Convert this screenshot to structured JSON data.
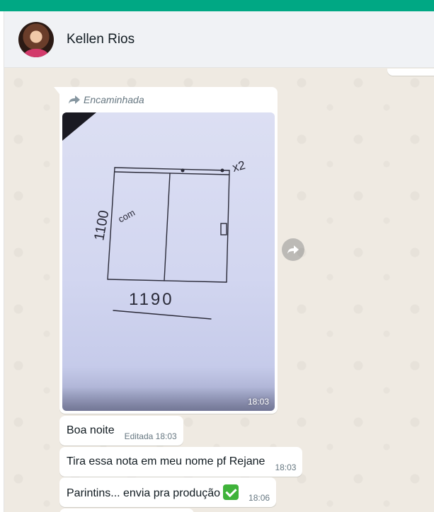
{
  "header": {
    "contact_name": "Kellen Rios"
  },
  "messages": {
    "media": {
      "forwarded_label": "Encaminhada",
      "time": "18:03",
      "drawing": {
        "label_height": "1100",
        "label_width": "1190",
        "label_qty": "x2",
        "label_note": "com"
      }
    },
    "m1": {
      "text": "Boa noite",
      "meta": "Editada 18:03"
    },
    "m2": {
      "text": "Tira essa nota em meu nome pf Rejane",
      "meta": "18:03"
    },
    "m3": {
      "text": "Parintins... envia pra produção",
      "meta": "18:06",
      "emoji": "check-mark-button-emoji"
    }
  },
  "colors": {
    "accent": "#00a884",
    "header_bg": "#f0f2f5",
    "chat_bg": "#efeae2",
    "bubble_bg": "#ffffff",
    "meta_text": "#667781"
  }
}
